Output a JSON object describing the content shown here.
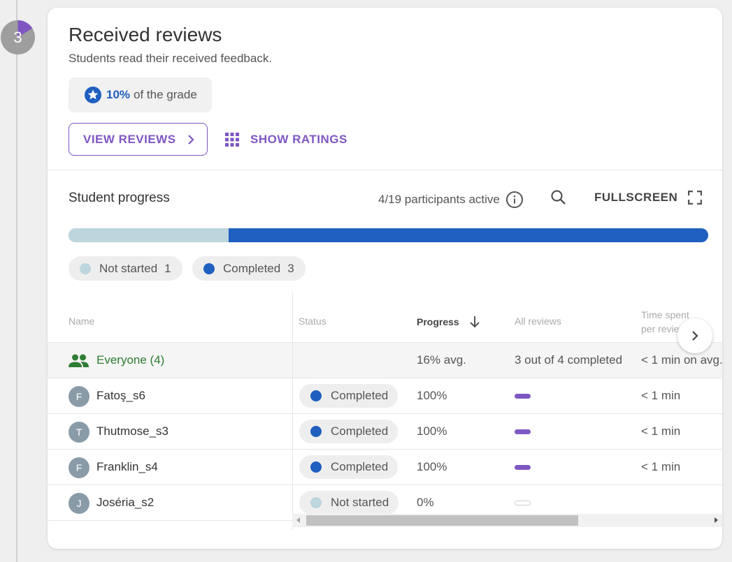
{
  "step": {
    "number": "3",
    "progress_fraction": 0.16
  },
  "header": {
    "title": "Received reviews",
    "subtitle": "Students read their received feedback.",
    "grade_percent": "10%",
    "grade_suffix": "of the grade"
  },
  "actions": {
    "view_reviews_label": "VIEW REVIEWS",
    "show_ratings_label": "SHOW RATINGS"
  },
  "student_progress": {
    "title": "Student progress",
    "active_text": "4/19 participants active",
    "fullscreen_label": "FULLSCREEN",
    "bar": {
      "not_started_fraction": 0.25,
      "completed_fraction": 0.75
    },
    "legend": [
      {
        "label": "Not started",
        "count": "1",
        "color": "#bdd5dc"
      },
      {
        "label": "Completed",
        "count": "3",
        "color": "#1f5fbf"
      }
    ]
  },
  "table": {
    "columns": {
      "name": "Name",
      "status": "Status",
      "progress": "Progress",
      "all_reviews": "All reviews",
      "time_spent_line1": "Time spent",
      "time_spent_line2": "per review"
    },
    "everyone": {
      "label": "Everyone (4)",
      "progress": "16% avg.",
      "reviews": "3 out of 4 completed",
      "time": "< 1 min on avg."
    },
    "rows": [
      {
        "initial": "F",
        "name": "Fatoş_s6",
        "status": "Completed",
        "status_color": "#1f5fbf",
        "progress": "100%",
        "reviews_done": true,
        "time": "< 1 min"
      },
      {
        "initial": "T",
        "name": "Thutmose_s3",
        "status": "Completed",
        "status_color": "#1f5fbf",
        "progress": "100%",
        "reviews_done": true,
        "time": "< 1 min"
      },
      {
        "initial": "F",
        "name": "Franklin_s4",
        "status": "Completed",
        "status_color": "#1f5fbf",
        "progress": "100%",
        "reviews_done": true,
        "time": "< 1 min"
      },
      {
        "initial": "J",
        "name": "Joséria_s2",
        "status": "Not started",
        "status_color": "#bdd5dc",
        "progress": "0%",
        "reviews_done": false,
        "time": ""
      }
    ]
  },
  "colors": {
    "accent_purple": "#7e57c2",
    "completed_blue": "#1f5fbf",
    "not_started": "#bdd5dc",
    "everyone_green": "#2e7d32"
  },
  "icons": {
    "grade": "star-circle-icon",
    "view_reviews": "chevron-right-icon",
    "show_ratings": "grid-icon",
    "info": "info-icon",
    "search": "search-icon",
    "fullscreen": "fullscreen-icon",
    "everyone": "group-icon",
    "sort": "arrow-down-icon"
  }
}
